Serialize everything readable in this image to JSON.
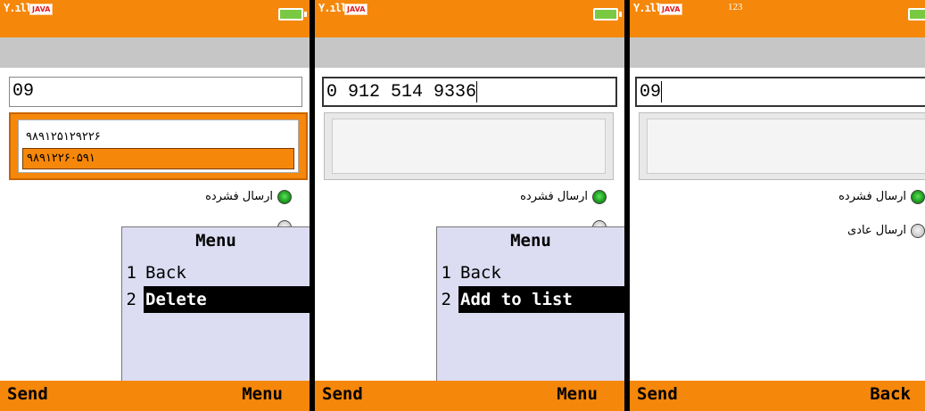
{
  "screens": [
    {
      "status": {
        "signal": "Y.ıll",
        "java_badge": "JAVA",
        "indicator": ""
      },
      "number_input": {
        "value": "09"
      },
      "suggestions": [
        "۹۸۹۱۲۵۱۲۹۲۲۶",
        "۹۸۹۱۲۲۶۰۵۹۱"
      ],
      "radios": [
        {
          "label": "ارسال فشرده",
          "checked": true
        }
      ],
      "menu": {
        "title": "Menu",
        "items": [
          {
            "num": "1",
            "label": "Back"
          },
          {
            "num": "2",
            "label": "Delete"
          }
        ]
      },
      "softkeys": {
        "left": "Send",
        "right": "Menu"
      }
    },
    {
      "status": {
        "signal": "Y.ıll",
        "java_badge": "JAVA",
        "indicator": ""
      },
      "number_input": {
        "value": "0 912 514 9336"
      },
      "radios": [
        {
          "label": "ارسال فشرده",
          "checked": true
        }
      ],
      "menu": {
        "title": "Menu",
        "items": [
          {
            "num": "1",
            "label": "Back"
          },
          {
            "num": "2",
            "label": "Add to list"
          }
        ]
      },
      "softkeys": {
        "left": "Send",
        "right": "Menu"
      }
    },
    {
      "status": {
        "signal": "Y.ıll",
        "java_badge": "JAVA",
        "indicator": "123"
      },
      "number_input": {
        "value": "09"
      },
      "radios": [
        {
          "label": "ارسال فشرده",
          "checked": true
        },
        {
          "label": "ارسال عادی",
          "checked": false
        }
      ],
      "softkeys": {
        "left": "Send",
        "right": "Back"
      }
    }
  ],
  "colors": {
    "accent": "#f5870a",
    "title_bar": "#c6c6c6",
    "menu_bg": "#dcdcf2",
    "radio_on": "#1fa01f"
  }
}
